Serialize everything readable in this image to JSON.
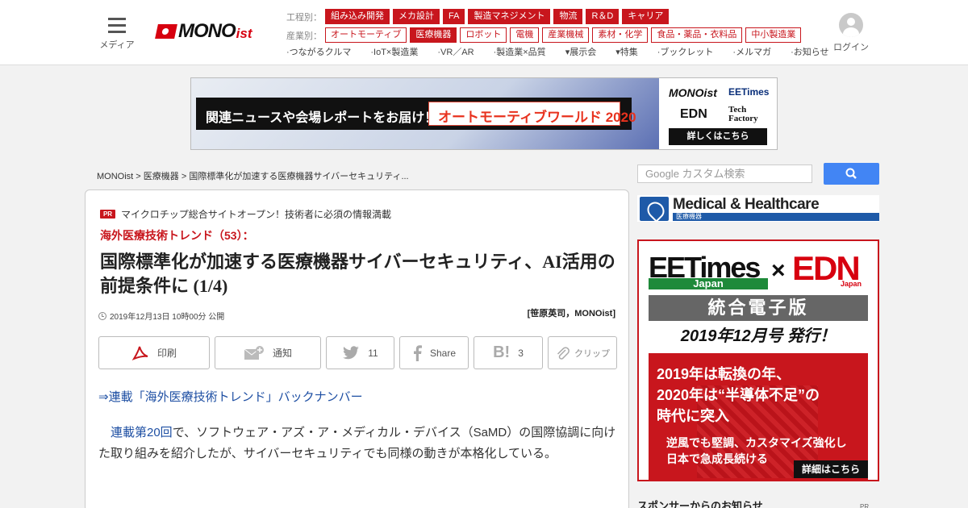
{
  "header": {
    "menu_label": "メディア",
    "logo_text": "MONO",
    "logo_suffix": "ist",
    "process_label": "工程別：",
    "process_tags": [
      "組み込み開発",
      "メカ設計",
      "FA",
      "製造マネジメント",
      "物流",
      "R＆D",
      "キャリア"
    ],
    "industry_label": "産業別：",
    "industry_tags": [
      "オートモーティブ",
      "医療機器",
      "ロボット",
      "電機",
      "産業機械",
      "素材・化学",
      "食品・薬品・衣料品",
      "中小製造業"
    ],
    "industry_active": "医療機器",
    "links": [
      "つながるクルマ",
      "IoT×製造業",
      "VR／AR",
      "製造業×品質",
      "展示会",
      "特集",
      "ブックレット",
      "メルマガ",
      "お知らせ"
    ],
    "login_label": "ログイン"
  },
  "banner": {
    "text1": "関連ニュースや会場レポートをお届け！",
    "text2": "オートモーティブワールド 2020",
    "m1": "MONOist",
    "m2": "EETimes",
    "m3": "EDN",
    "m4": "Tech Factory",
    "cta": "詳しくはこちら"
  },
  "breadcrumb": {
    "home": "MONOist",
    "sep": " > ",
    "category": "医療機器",
    "current": "国際標準化が加速する医療機器サイバーセキュリティ..."
  },
  "article": {
    "pr_badge": "PR",
    "pr_text": "マイクロチップ総合サイトオープン！技術者に必須の情報満載",
    "series": "海外医療技術トレンド（53）：",
    "title": "国際標準化が加速する医療機器サイバーセキュリティ、AI活用の前提条件に (1/4)",
    "date": "2019年12月13日 10時00分 公開",
    "author": "[笹原英司，MONOist]",
    "buttons": {
      "print": "印刷",
      "notify": "通知",
      "tweet_count": "11",
      "share": "Share",
      "hatena_count": "3",
      "clip": "クリップ"
    },
    "backnumber": "⇒連載「海外医療技術トレンド」バックナンバー",
    "body_link": "連載第20回",
    "body_text": "で、ソフトウェア・アズ・ア・メディカル・デバイス（SaMD）の国際協調に向けた取り組みを紹介したが、サイバーセキュリティでも同様の動きが本格化している。"
  },
  "sidebar": {
    "search_placeholder": "Google カスタム検索",
    "medical_title": "Medical & Healthcare",
    "medical_sub": "医療機器",
    "ad": {
      "ee": "EETimes",
      "ee_japan": "Japan",
      "x": "×",
      "edn": "EDN",
      "edn_japan": "Japan",
      "gray": "統合電子版",
      "issue": "2019年12月号 発行！",
      "line1": "2019年は転換の年、",
      "line2": "2020年は“半導体不足”の",
      "line3": "時代に突入",
      "line4": "逆風でも堅調、カスタマイズ強化し",
      "line5": "日本で急成長続ける",
      "cta": "詳細はこちら"
    },
    "sponsor_title": "スポンサーからのお知らせ",
    "sponsor_pr": "PR"
  },
  "colors": {
    "brand_red": "#c8161d",
    "link_blue": "#1e4fa3",
    "search_blue": "#4285f4"
  }
}
